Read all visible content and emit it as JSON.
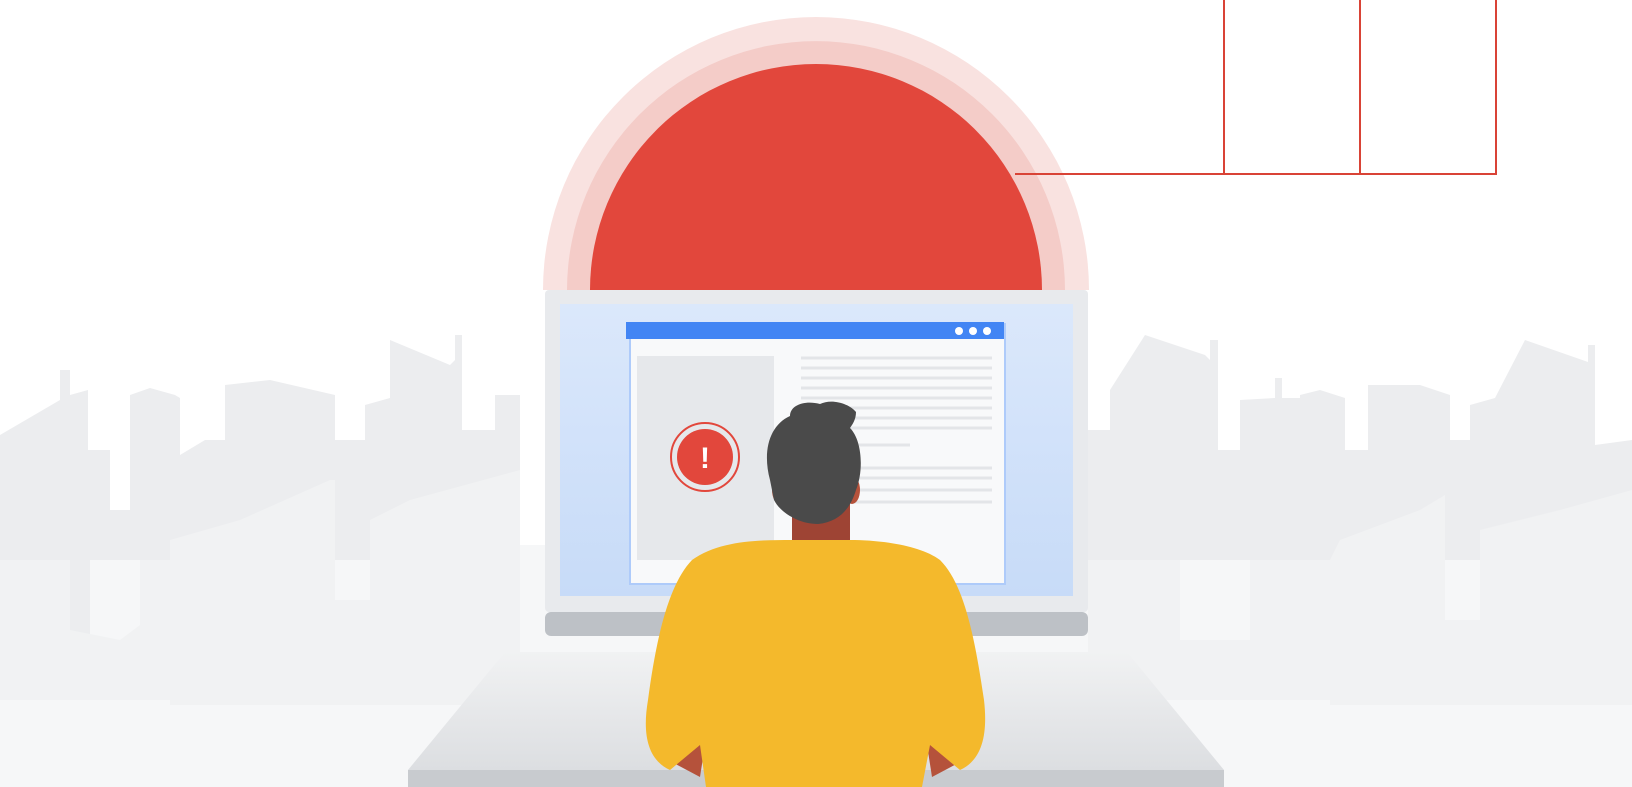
{
  "illustration": {
    "subject": "person-at-laptop-with-warning",
    "icons": [
      "exclamation-icon",
      "window-dots-icon"
    ],
    "warning_glyph": "!",
    "colors": {
      "sun_red": "#E2473C",
      "sun_halo_outer": "#F9E2E0",
      "sun_halo_inner": "#F4CCC8",
      "accent_line": "#D94336",
      "browser_bar_blue": "#4285F4",
      "screen_blue": "#D6E6FB",
      "laptop_gray": "#E8EAED",
      "laptop_base": "#BDC1C6",
      "skyline_gray": "#ECEDEF",
      "hair": "#4A4A4A",
      "skin": "#B5523B",
      "shirt_yellow": "#F4B92C"
    }
  }
}
